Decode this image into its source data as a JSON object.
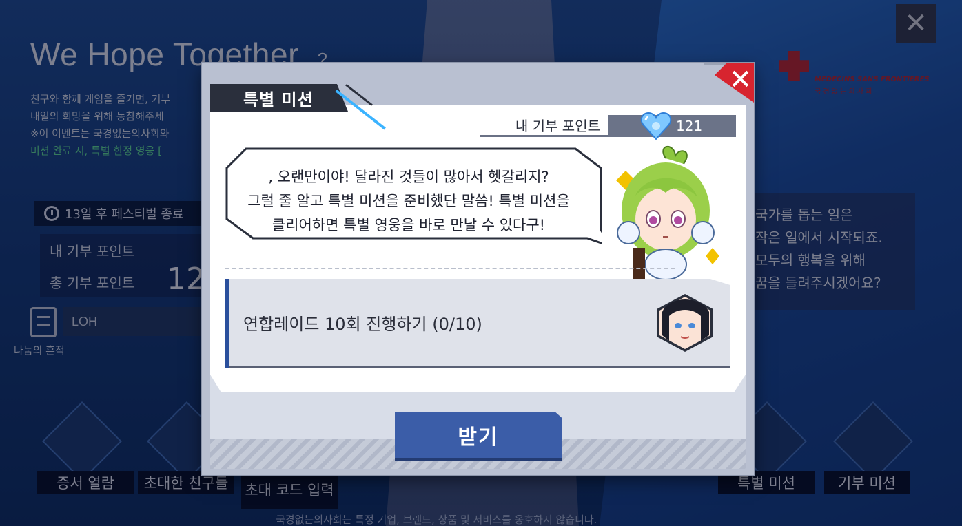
{
  "background": {
    "title": "We Hope Together",
    "title_suffix": "?",
    "desc_line1": "친구와 함께 게임을 즐기면, 기부",
    "desc_line2": "내일의 희망을 위해 동참해주세",
    "desc_line3": "※이 이벤트는 국경없는의사회와",
    "desc_line4": "미션 완료 시, 특별 한정 영웅 [",
    "festival_text": "13일 후 페스티벌 종료",
    "my_points_label": "내 기부 포인트",
    "total_points_label": "총 기부 포인트",
    "total_points_partial": "12",
    "trace_label": "나눔의 흔적",
    "loh_label": "LOH",
    "side_line1": "국가를 돕는 일은",
    "side_line2": "작은 일에서 시작되죠.",
    "side_line3": "모두의 행복을 위해",
    "side_line4": "꿈을 들려주시겠어요?",
    "msf_name": "MEDECINS SANS FRONTIERES",
    "msf_korean": "국 경 없 는 의 사 회",
    "menu": [
      "증서 열람",
      "초대한 친구들",
      "초대 코드 입력",
      "특별 미션",
      "기부 미션"
    ],
    "footer_text": "국경없는의사회는 특정 기업, 브랜드, 상품 및 서비스를 옹호하지 않습니다.",
    "close_symbol": "✕"
  },
  "modal": {
    "tab_title": "특별 미션",
    "close_symbol": "✕",
    "points_label": "내 기부 포인트",
    "points_value": "121",
    "speech_line1": ", 오랜만이야! 달라진 것들이 많아서 헷갈리지?",
    "speech_line2": "그럴 줄 알고 특별 미션을 준비했단 말씀! 특별 미션을",
    "speech_line3": "클리어하면 특별 영웅을 바로 만날 수 있다구!",
    "mission_text": "연합레이드 10회 진행하기 (0/10)",
    "receive_button": "받기"
  },
  "colors": {
    "accent_blue": "#3b5da8",
    "close_red": "#d7242f",
    "tab_dark": "#2a2f3c",
    "npc_hair": "#9bcf4a"
  },
  "icons": {
    "heart": "heart-gem-icon",
    "clock": "clock-icon",
    "list": "list-icon",
    "close": "close-icon"
  }
}
